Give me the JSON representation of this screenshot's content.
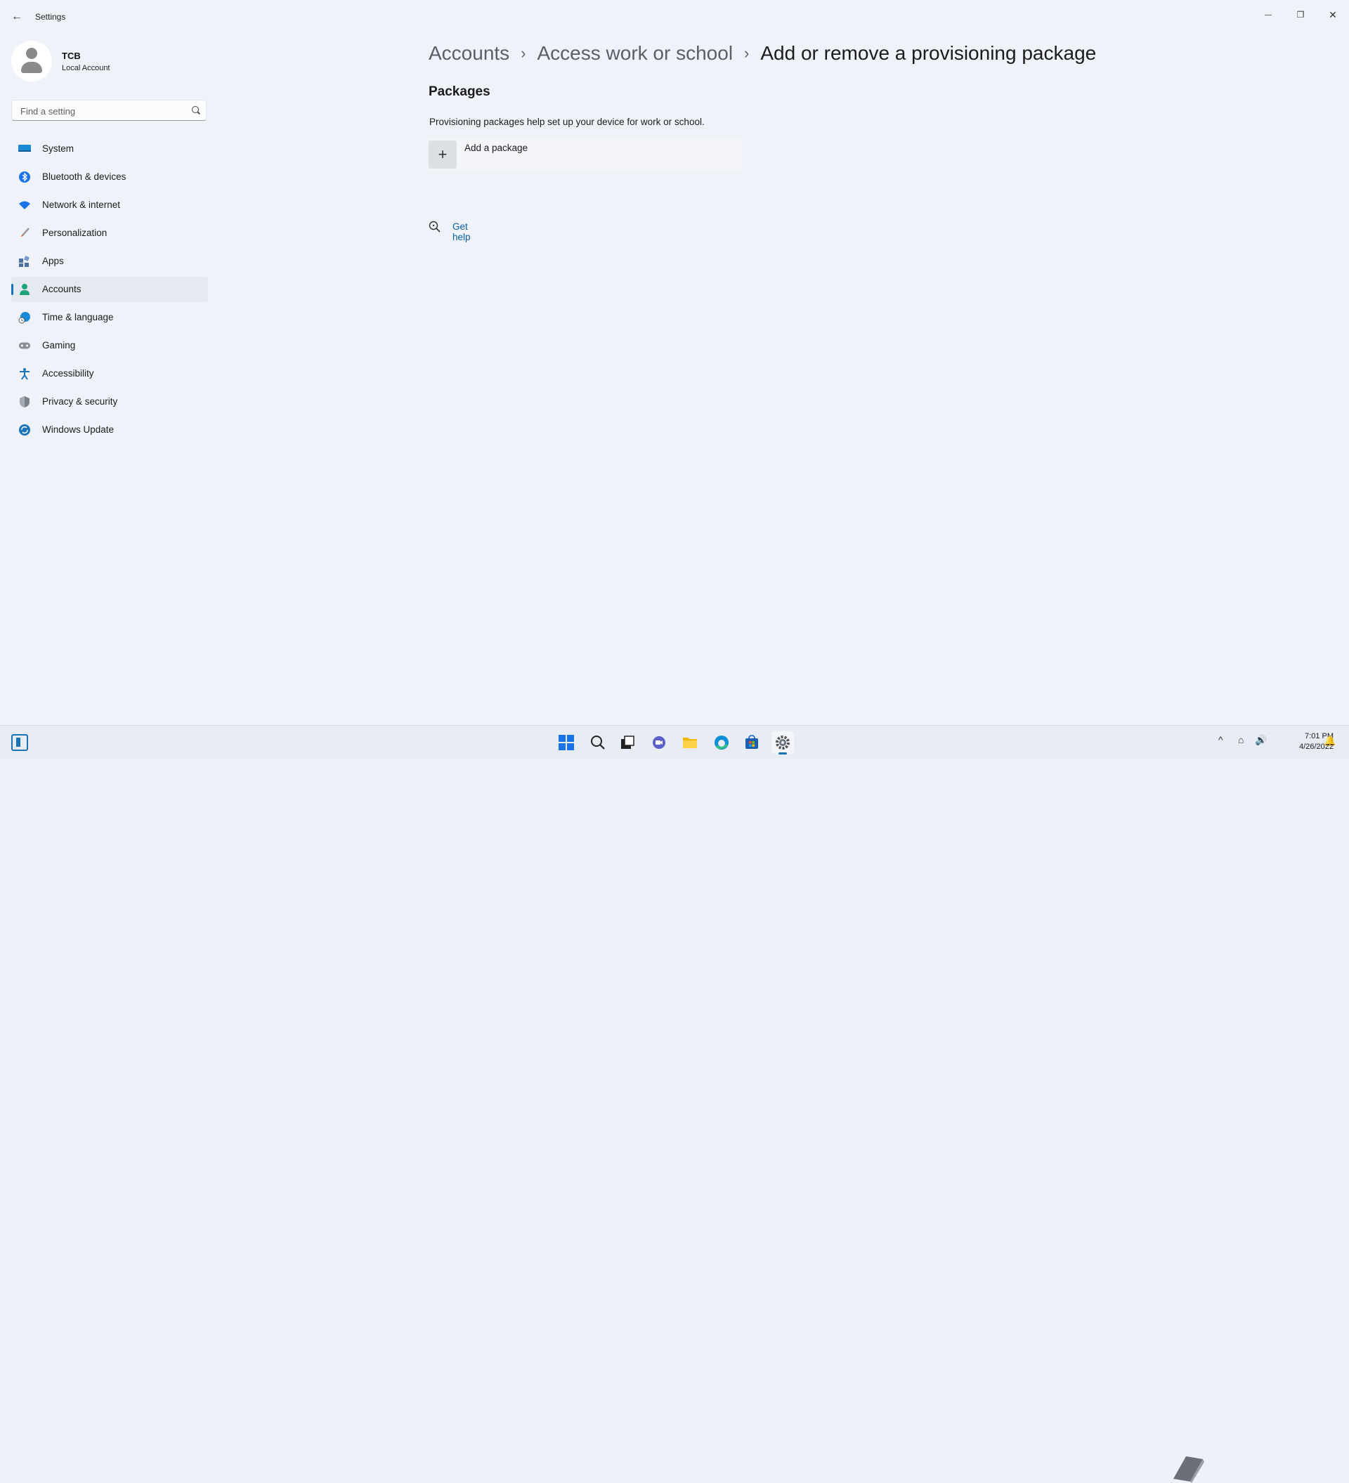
{
  "window": {
    "title": "Settings",
    "back_glyph": "←",
    "controls": {
      "minimize": "—",
      "maximize": "❐",
      "close": "✕"
    }
  },
  "profile": {
    "name": "TCB",
    "account_type": "Local Account"
  },
  "search": {
    "placeholder": "Find a setting"
  },
  "sidebar": {
    "items": [
      {
        "label": "System",
        "icon": "monitor-icon",
        "color": "#1a8ad4",
        "selected": false
      },
      {
        "label": "Bluetooth & devices",
        "icon": "bluetooth-icon",
        "color": "#1a73e8",
        "selected": false
      },
      {
        "label": "Network & internet",
        "icon": "wifi-icon",
        "color": "#1a73e8",
        "selected": false
      },
      {
        "label": "Personalization",
        "icon": "brush-icon",
        "color": "#d2691e",
        "selected": false
      },
      {
        "label": "Apps",
        "icon": "apps-icon",
        "color": "#4a6fa5",
        "selected": false
      },
      {
        "label": "Accounts",
        "icon": "person-icon",
        "color": "#1fa37a",
        "selected": true
      },
      {
        "label": "Time & language",
        "icon": "globe-clock-icon",
        "color": "#1a8ad4",
        "selected": false
      },
      {
        "label": "Gaming",
        "icon": "gamepad-icon",
        "color": "#6b7280",
        "selected": false
      },
      {
        "label": "Accessibility",
        "icon": "accessibility-icon",
        "color": "#1a73b8",
        "selected": false
      },
      {
        "label": "Privacy & security",
        "icon": "shield-icon",
        "color": "#6b7280",
        "selected": false
      },
      {
        "label": "Windows Update",
        "icon": "update-icon",
        "color": "#1a73b8",
        "selected": false
      }
    ]
  },
  "breadcrumb": {
    "items": [
      "Accounts",
      "Access work or school"
    ],
    "current": "Add or remove a provisioning package",
    "separator": "›"
  },
  "packages": {
    "title": "Packages",
    "description": "Provisioning packages help set up your device for work or school.",
    "add_label": "Add a package",
    "add_glyph": "+"
  },
  "help": {
    "label": "Get help"
  },
  "taskbar": {
    "time": "7:01 PM",
    "date": "4/26/2022",
    "tray_glyphs": {
      "chevron": "^",
      "network": "⌂",
      "volume": "🔊",
      "notifications": "🔔"
    }
  },
  "colors": {
    "accent": "#1a73b8",
    "link": "#0a5fa8",
    "background": "#eff3f9"
  }
}
